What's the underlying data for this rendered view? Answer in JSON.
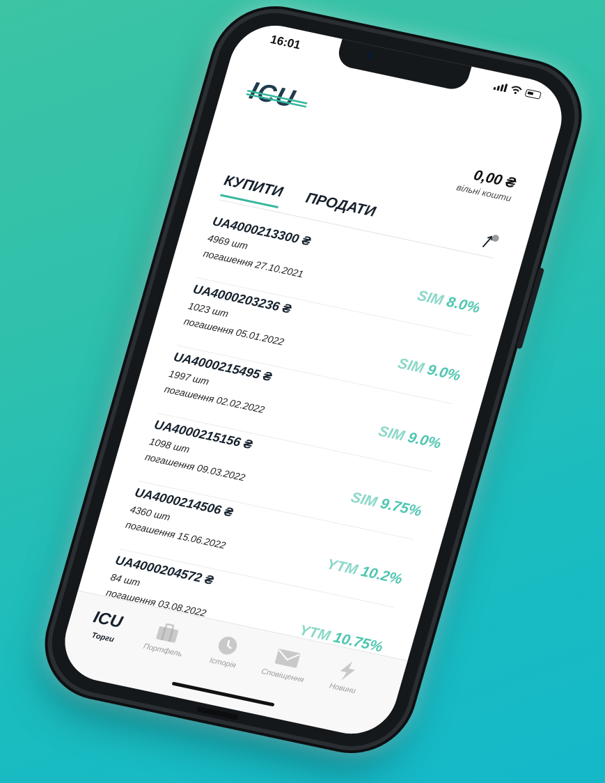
{
  "status_bar": {
    "time": "16:01"
  },
  "header": {
    "logo": "ICU",
    "balance_amount": "0,00 ₴",
    "balance_label": "вільні кошти"
  },
  "tabs": [
    {
      "label": "КУПИТИ",
      "active": true
    },
    {
      "label": "ПРОДАТИ",
      "active": false
    }
  ],
  "bonds": [
    {
      "code": "UA4000213300 ₴",
      "quantity": "4969 шт",
      "maturity": "погашення 27.10.2021",
      "yield_type": "SIM",
      "yield_value": "8.0%"
    },
    {
      "code": "UA4000203236 ₴",
      "quantity": "1023 шт",
      "maturity": "погашення 05.01.2022",
      "yield_type": "SIM",
      "yield_value": "9.0%"
    },
    {
      "code": "UA4000215495 ₴",
      "quantity": "1997 шт",
      "maturity": "погашення 02.02.2022",
      "yield_type": "SIM",
      "yield_value": "9.0%"
    },
    {
      "code": "UA4000215156 ₴",
      "quantity": "1098 шт",
      "maturity": "погашення 09.03.2022",
      "yield_type": "SIM",
      "yield_value": "9.75%"
    },
    {
      "code": "UA4000214506 ₴",
      "quantity": "4360 шт",
      "maturity": "погашення 15.06.2022",
      "yield_type": "YTM",
      "yield_value": "10.2%"
    },
    {
      "code": "UA4000204572 ₴",
      "quantity": "84 шт",
      "maturity": "погашення 03.08.2022",
      "yield_type": "YTM",
      "yield_value": "10.75%"
    }
  ],
  "tabbar": {
    "items": [
      {
        "label": "Торги",
        "icon": "icu-logo-icon",
        "glyph": "ICU",
        "active": true
      },
      {
        "label": "Портфель",
        "icon": "briefcase-icon",
        "active": false
      },
      {
        "label": "Історія",
        "icon": "clock-icon",
        "active": false
      },
      {
        "label": "Сповіщення",
        "icon": "envelope-icon",
        "active": false
      },
      {
        "label": "Новини",
        "icon": "lightning-icon",
        "active": false
      }
    ]
  },
  "colors": {
    "accent": "#35b79d",
    "yield_value": "#4fc6b1",
    "yield_label": "#8ad8c8",
    "text_dark": "#16202b",
    "background_start": "#3cc4a4",
    "background_end": "#14b8c9"
  }
}
